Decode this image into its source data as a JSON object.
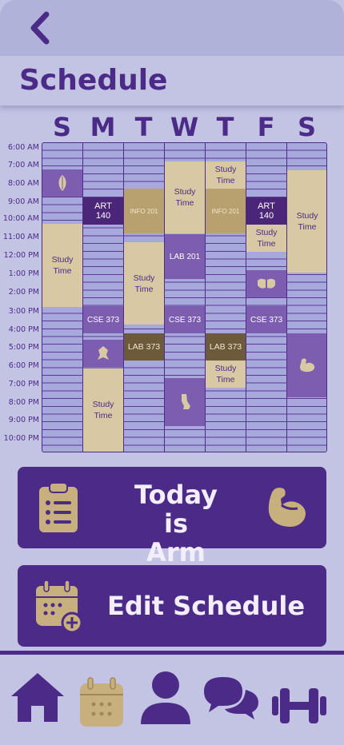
{
  "header": {
    "title": "Schedule"
  },
  "days": [
    "S",
    "M",
    "T",
    "W",
    "T",
    "F",
    "S"
  ],
  "times": [
    "6:00 AM",
    "7:00 AM",
    "8:00 AM",
    "9:00 AM",
    "10:00 AM",
    "11:00 AM",
    "12:00 PM",
    "1:00 PM",
    "2:00 PM",
    "3:00 PM",
    "4:00 PM",
    "5:00 PM",
    "6:00 PM",
    "7:00 PM",
    "8:00 PM",
    "9:00 PM",
    "10:00 PM"
  ],
  "events": {
    "art140_mon": "ART 140",
    "info201_tue": "INFO 201",
    "study_wed_morning": "Study Time",
    "study_thu_morning": "Study Time",
    "info201_thu": "INFO 201",
    "art140_fri": "ART 140",
    "study_sat": "Study Time",
    "study_sun": "Study Time",
    "study_tue": "Study Time",
    "lab201_wed": "LAB 201",
    "study_fri": "Study Time",
    "cse373_mon": "CSE 373",
    "cse373_wed": "CSE 373",
    "cse373_fri": "CSE 373",
    "lab373_tue": "LAB 373",
    "lab373_thu": "LAB 373",
    "study_thu_evening": "Study Time",
    "study_mon_evening": "Study Time"
  },
  "actions": {
    "today_line1": "Today is",
    "today_line2": "Arm Day",
    "edit_schedule": "Edit Schedule"
  },
  "icons": {
    "back": "chevron-left-icon",
    "clipboard": "clipboard-list-icon",
    "arm": "flexed-biceps-icon",
    "calendar_add": "calendar-plus-icon",
    "home": "home-icon",
    "calendar": "calendar-icon",
    "profile": "user-icon",
    "chat": "chat-icon",
    "fitness": "dumbbell-icon"
  },
  "colors": {
    "accent": "#4b2a88",
    "gold": "#b8a16f",
    "study": "#d8c9a4",
    "background": "#c3c4e4"
  }
}
